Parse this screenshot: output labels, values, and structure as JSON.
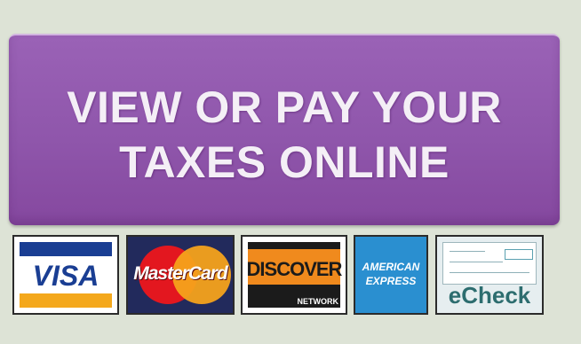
{
  "button": {
    "line1": "VIEW OR PAY YOUR",
    "line2": "TAXES ONLINE"
  },
  "cards": {
    "visa": "VISA",
    "mastercard": "MasterCard",
    "discover": "DISCOVER",
    "discover_sub": "NETWORK",
    "amex_line1": "AMERICAN",
    "amex_line2": "EXPRESS",
    "echeck": "eCheck"
  },
  "colors": {
    "background": "#dde3d6",
    "button": "#8f56ab",
    "button_text": "#f4eff6",
    "visa_blue": "#1a3e93",
    "visa_gold": "#f4a81c",
    "mc_red": "#e3171f",
    "mc_yellow": "#f6a21b",
    "discover_orange": "#f08a1d",
    "amex_blue": "#2a8fd0",
    "echeck_text": "#2d6d6f"
  }
}
